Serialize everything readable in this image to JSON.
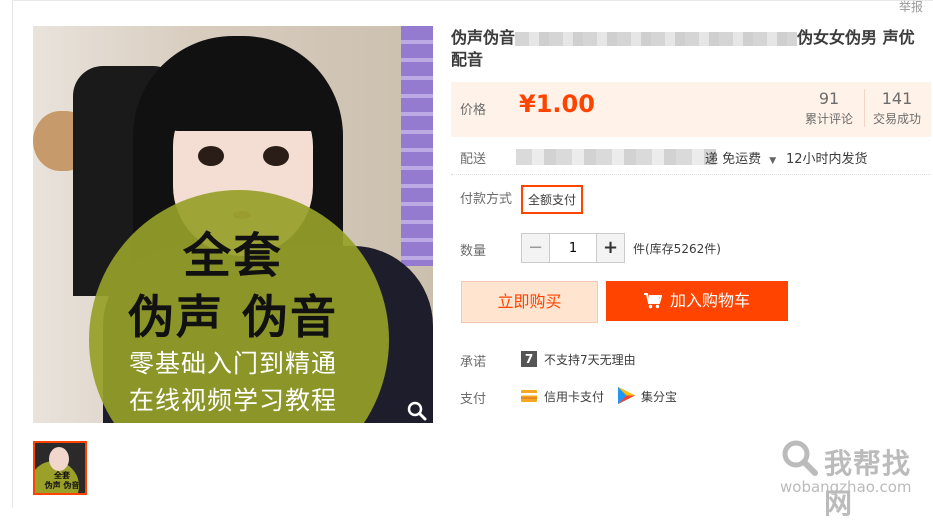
{
  "header": {
    "report_link": "举报"
  },
  "gallery": {
    "main_image_alt": "product-image",
    "overlay_line1": "全套",
    "overlay_line2": "伪声  伪音",
    "overlay_line3": "零基础入门到精通",
    "overlay_line4": "在线视频学习教程",
    "thumb_line1": "全套",
    "thumb_line2": "伪声 伪音"
  },
  "product": {
    "title_start": "伪声伪音",
    "title_end_line1": "伪女女伪男 声优",
    "title_line2": "配音"
  },
  "price": {
    "label": "价格",
    "value": "¥1.00",
    "reviews_count": "91",
    "reviews_label": "累计评论",
    "deals_count": "141",
    "deals_label": "交易成功"
  },
  "shipping": {
    "label": "配送",
    "free_text": "递 免运费",
    "time_text": "12小时内发货"
  },
  "payment_method": {
    "label": "付款方式",
    "option": "全额支付"
  },
  "quantity": {
    "label": "数量",
    "value": "1",
    "minus": "−",
    "plus": "+",
    "stock": "件(库存5262件)"
  },
  "actions": {
    "buy_now": "立即购买",
    "add_to_cart": "加入购物车"
  },
  "promise": {
    "label": "承诺",
    "badge": "7",
    "text": "不支持7天无理由"
  },
  "pay": {
    "label": "支付",
    "credit_card": "信用卡支付",
    "jifenbao": "集分宝"
  },
  "watermark": {
    "cn": "我帮找网",
    "url": "wobangzhao.com"
  },
  "colors": {
    "accent": "#ff4400",
    "price_bg": "#fff2e8"
  }
}
